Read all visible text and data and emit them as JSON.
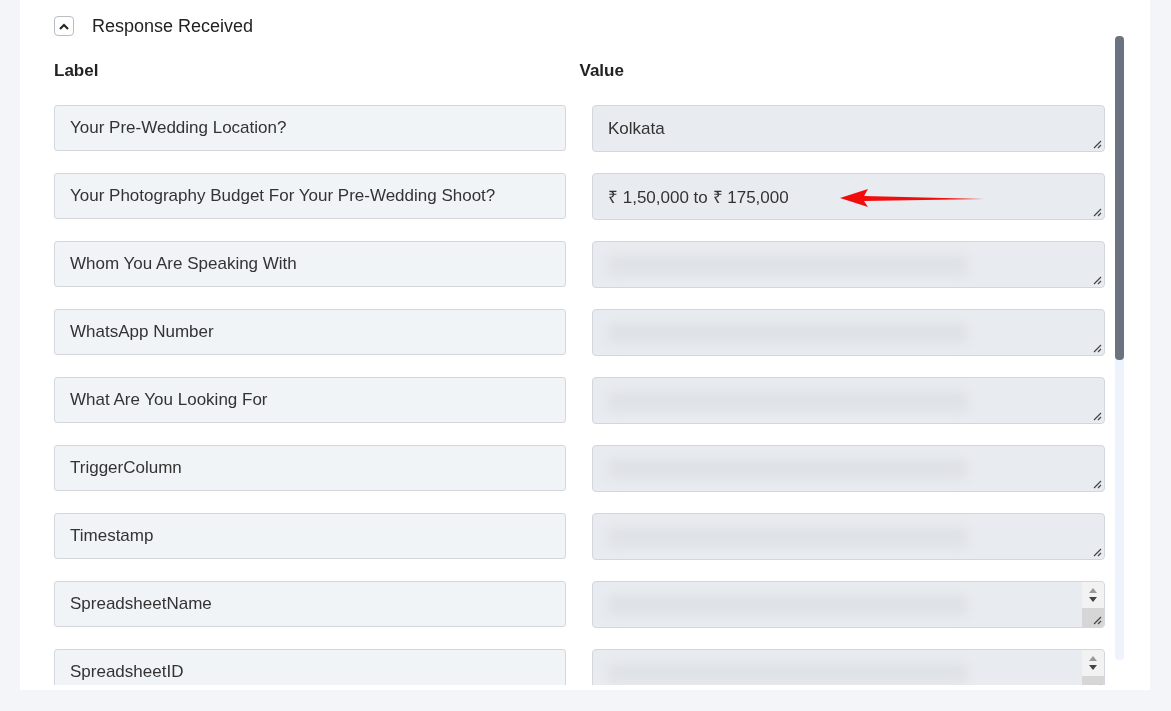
{
  "section": {
    "title": "Response Received",
    "expanded": true
  },
  "columns": {
    "label": "Label",
    "value": "Value"
  },
  "rows": [
    {
      "label": "Your Pre-Wedding Location?",
      "value": "Kolkata",
      "blurred": false,
      "scrollable": false,
      "highlighted": false
    },
    {
      "label": "Your Photography Budget For Your Pre-Wedding Shoot?",
      "value": "₹ 1,50,000 to ₹ 175,000",
      "blurred": false,
      "scrollable": false,
      "highlighted": true
    },
    {
      "label": "Whom You Are Speaking With",
      "blurred": true,
      "scrollable": false,
      "highlighted": false
    },
    {
      "label": "WhatsApp Number",
      "blurred": true,
      "scrollable": false,
      "highlighted": false
    },
    {
      "label": "What Are You Looking For",
      "blurred": true,
      "scrollable": false,
      "highlighted": false
    },
    {
      "label": "TriggerColumn",
      "blurred": true,
      "scrollable": false,
      "highlighted": false
    },
    {
      "label": "Timestamp",
      "blurred": true,
      "scrollable": false,
      "highlighted": false
    },
    {
      "label": "SpreadsheetName",
      "blurred": true,
      "scrollable": true,
      "highlighted": false
    },
    {
      "label": "SpreadsheetID",
      "blurred": true,
      "scrollable": true,
      "highlighted": false
    }
  ]
}
